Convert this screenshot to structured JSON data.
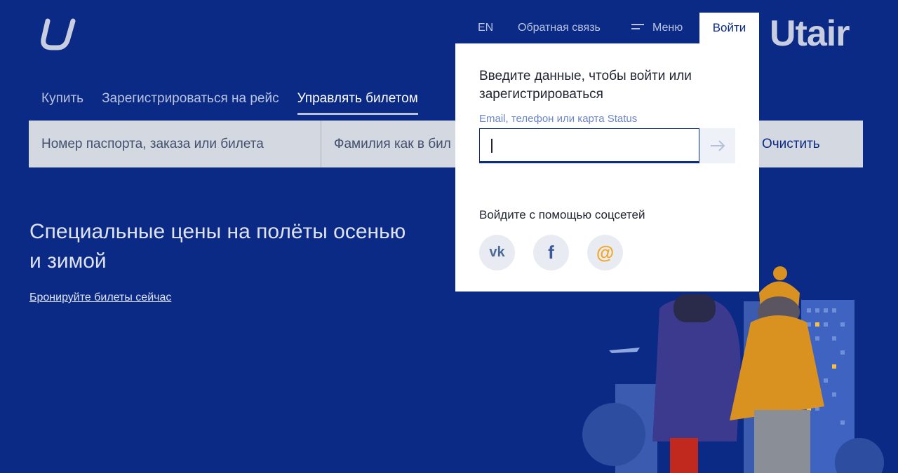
{
  "header": {
    "lang": "EN",
    "feedback": "Обратная связь",
    "menu": "Меню",
    "login": "Войти",
    "brand": "Utair"
  },
  "tabs": [
    {
      "label": "Купить"
    },
    {
      "label": "Зарегистрироваться на рейс"
    },
    {
      "label": "Управлять билетом",
      "active": true
    }
  ],
  "search": {
    "field1_placeholder": "Номер паспорта, заказа или билета",
    "field2_placeholder": "Фамилия как в бил",
    "clear_label": "Очистить"
  },
  "promo": {
    "title": "Специальные цены на полёты осенью и зимой",
    "link": "Бронируйте билеты сейчас"
  },
  "login_popup": {
    "title": "Введите данные, чтобы войти или зарегистрироваться",
    "input_label": "Email, телефон или карта Status",
    "input_value": "",
    "social_title": "Войдите с помощью соцсетей",
    "social": [
      {
        "name": "vk",
        "glyph": "vk",
        "color": "#4c6a95"
      },
      {
        "name": "facebook",
        "glyph": "f",
        "color": "#3b5998"
      },
      {
        "name": "mail",
        "glyph": "@",
        "color": "#f5a623"
      }
    ]
  },
  "colors": {
    "background": "#0a2a86",
    "accent": "#0a2a86",
    "popup_bg": "#ffffff",
    "label_blue": "#6b86c6"
  }
}
